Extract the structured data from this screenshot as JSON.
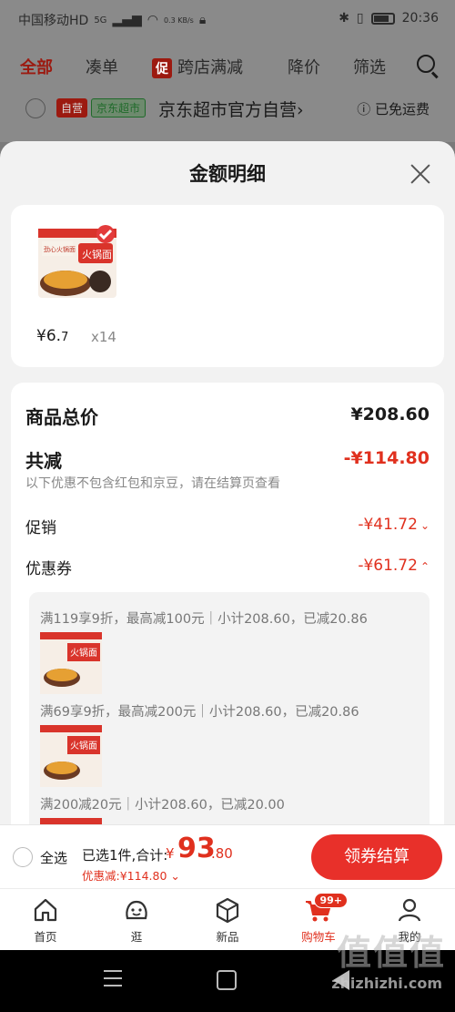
{
  "status_bar": {
    "carrier": "中国移动HD",
    "net": "5G",
    "speed": "0.3 KB/s",
    "time": "20:36"
  },
  "filter_bar": {
    "all": "全部",
    "bundle": "凑单",
    "promo_tag": "促",
    "cross_store": "跨店满减",
    "price_drop": "降价",
    "filter": "筛选"
  },
  "store_row": {
    "tag_self": "自营",
    "tag_jd": "京东超市",
    "name": "京东超市官方自营",
    "arrow": "›",
    "free_shipping": "ⓘ 已免运费"
  },
  "sheet": {
    "title": "金额明细",
    "product": {
      "price_symbol": "¥",
      "price_int": "6.",
      "price_dec": "7",
      "quantity": "x14"
    },
    "total_label": "商品总价",
    "total_value": "¥208.60",
    "reduced_label": "共减",
    "reduced_value": "-¥114.80",
    "note": "以下优惠不包含红包和京豆，请在结算页查看",
    "promo_label": "促销",
    "promo_value": "-¥41.72",
    "coupon_label": "优惠券",
    "coupon_value": "-¥61.72",
    "coupons": [
      "满119享9折，最高减100元｜小计208.60，已减20.86",
      "满69享9折，最高减200元｜小计208.60，已减20.86",
      "满200减20元｜小计208.60，已减20.00"
    ]
  },
  "checkout": {
    "select_all": "全选",
    "selected": "已选1件,合计:",
    "total_symbol": "¥",
    "total_int": "93",
    "total_dec": ".80",
    "discount": "优惠减:¥114.80 ⌄",
    "button": "领券结算"
  },
  "tabs": [
    {
      "label": "首页",
      "icon": "home-icon"
    },
    {
      "label": "逛",
      "icon": "discover-icon"
    },
    {
      "label": "新品",
      "icon": "box-icon"
    },
    {
      "label": "购物车",
      "icon": "cart-icon",
      "badge": "99+"
    },
    {
      "label": "我的",
      "icon": "profile-icon"
    }
  ],
  "watermark": {
    "main": "值值值",
    "sub": "zhizhizhi.com"
  },
  "colors": {
    "accent_red": "#e0301e",
    "button_red": "#e8302a"
  }
}
